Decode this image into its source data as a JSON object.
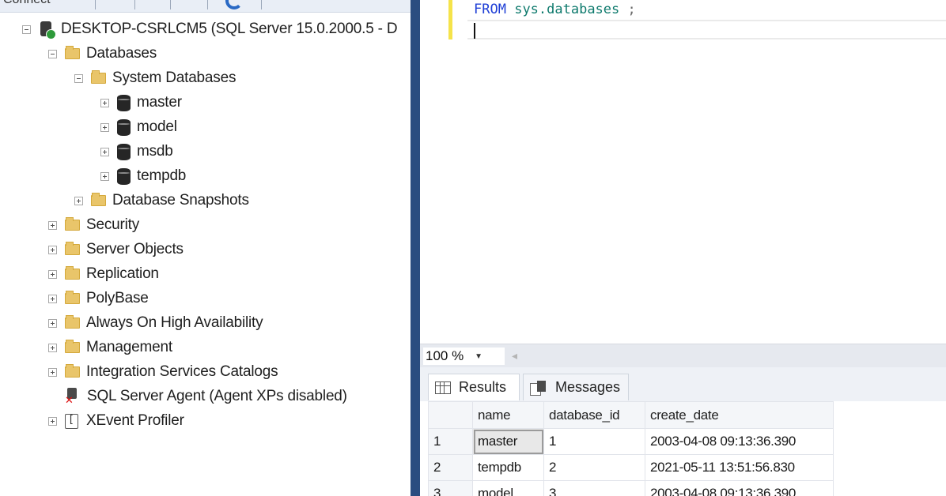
{
  "toolbar": {
    "connect_label": "Connect"
  },
  "object_explorer": {
    "server_label": "DESKTOP-CSRLCM5 (SQL Server 15.0.2000.5 - D",
    "items": [
      {
        "label": "Databases",
        "icon": "folder-icon",
        "expanded": true
      },
      {
        "label": "System Databases",
        "icon": "folder-icon",
        "expanded": true
      },
      {
        "label": "master",
        "icon": "database-icon",
        "expanded": false
      },
      {
        "label": "model",
        "icon": "database-icon",
        "expanded": false
      },
      {
        "label": "msdb",
        "icon": "database-icon",
        "expanded": false
      },
      {
        "label": "tempdb",
        "icon": "database-icon",
        "expanded": false
      },
      {
        "label": "Database Snapshots",
        "icon": "folder-icon",
        "expanded": false
      },
      {
        "label": "Security",
        "icon": "folder-icon",
        "expanded": false
      },
      {
        "label": "Server Objects",
        "icon": "folder-icon",
        "expanded": false
      },
      {
        "label": "Replication",
        "icon": "folder-icon",
        "expanded": false
      },
      {
        "label": "PolyBase",
        "icon": "folder-icon",
        "expanded": false
      },
      {
        "label": "Always On High Availability",
        "icon": "folder-icon",
        "expanded": false
      },
      {
        "label": "Management",
        "icon": "folder-icon",
        "expanded": false
      },
      {
        "label": "Integration Services Catalogs",
        "icon": "folder-icon",
        "expanded": false
      },
      {
        "label": "SQL Server Agent (Agent XPs disabled)",
        "icon": "agent-icon",
        "expanded": null
      },
      {
        "label": "XEvent Profiler",
        "icon": "xevent-icon",
        "expanded": false
      }
    ]
  },
  "editor": {
    "line1": {
      "keyword": "FROM",
      "identifier": "sys.databases",
      "terminator": ";"
    }
  },
  "zoom": {
    "value": "100 %"
  },
  "results": {
    "tabs": [
      {
        "label": "Results",
        "icon": "grid-icon"
      },
      {
        "label": "Messages",
        "icon": "messages-icon"
      }
    ],
    "columns": [
      "name",
      "database_id",
      "create_date"
    ],
    "rows": [
      {
        "num": "1",
        "name": "master",
        "database_id": "1",
        "create_date": "2003-04-08 09:13:36.390"
      },
      {
        "num": "2",
        "name": "tempdb",
        "database_id": "2",
        "create_date": "2021-05-11 13:51:56.830"
      },
      {
        "num": "3",
        "name": "model",
        "database_id": "3",
        "create_date": "2003-04-08 09:13:36.390"
      }
    ]
  },
  "colors": {
    "keyword": "#1f3fd6",
    "identifier": "#0e7a6d",
    "panel_divider": "#2b4d80",
    "change_bar": "#f5e34a"
  }
}
